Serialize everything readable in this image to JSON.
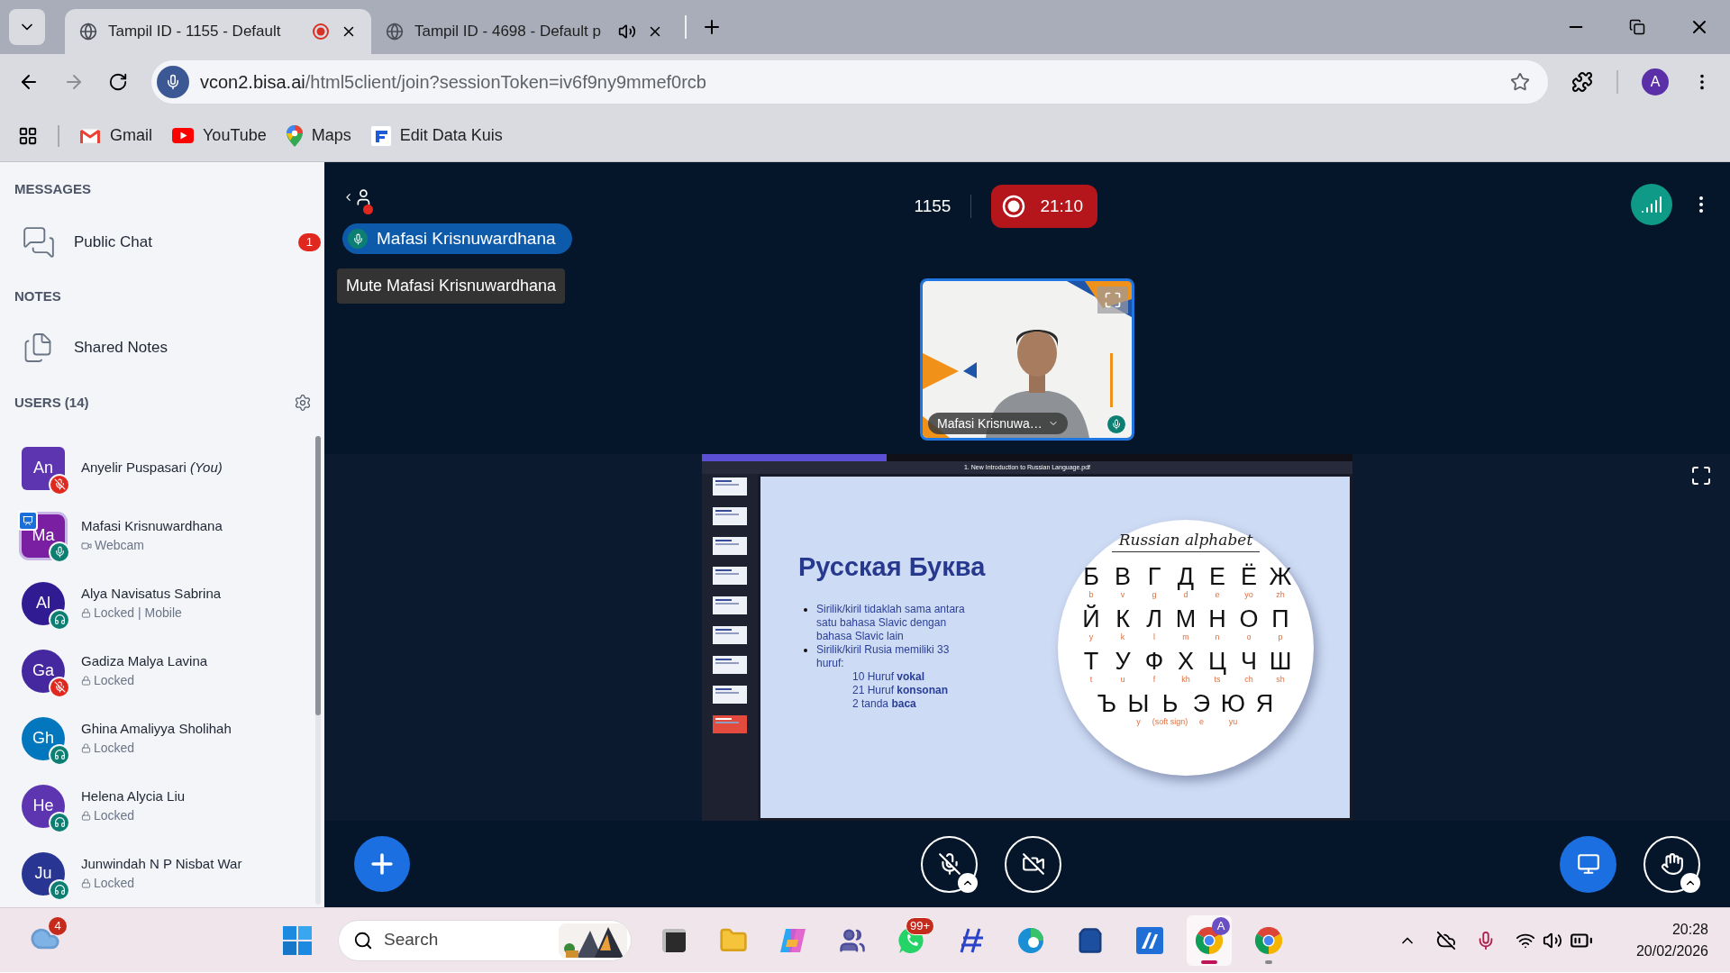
{
  "browser": {
    "tabs": [
      {
        "title": "Tampil ID - 1155 - Default",
        "selected": true,
        "recording": true,
        "playing_audio": false
      },
      {
        "title": "Tampil ID - 4698 - Default p",
        "selected": false,
        "recording": false,
        "playing_audio": true
      }
    ],
    "address": {
      "host": "vcon2.bisa.ai",
      "path": "/html5client/join?sessionToken=iv6f9ny9mmef0rcb"
    },
    "profile_initial": "A",
    "bookmarks": [
      {
        "label": "Gmail",
        "kind": "gmail"
      },
      {
        "label": "YouTube",
        "kind": "youtube"
      },
      {
        "label": "Maps",
        "kind": "maps"
      },
      {
        "label": "Edit Data Kuis",
        "kind": "flungo"
      }
    ]
  },
  "sidebar": {
    "messages_heading": "MESSAGES",
    "public_chat": {
      "label": "Public Chat",
      "unread": "1"
    },
    "notes_heading": "NOTES",
    "shared_notes": "Shared Notes",
    "users_heading": "USERS (14)",
    "users": [
      {
        "initials": "An",
        "name": "Anyelir Puspasari *(You)*",
        "color": "#5e35b1",
        "moderator": true,
        "presenter": false,
        "muted": true
      },
      {
        "initials": "Ma",
        "name": "Mafasi Krisnuwardhana",
        "color": "#7b1fa2",
        "moderator": true,
        "presenter": true,
        "muted": false,
        "listen_only": false,
        "status": {
          "kind": "webcam",
          "text": "Webcam"
        }
      },
      {
        "initials": "Al",
        "name": "Alya Navisatus Sabrina",
        "color": "#311b92",
        "moderator": false,
        "presenter": false,
        "muted": false,
        "listen_only": true,
        "status": {
          "kind": "lock",
          "text": "Locked | Mobile"
        }
      },
      {
        "initials": "Ga",
        "name": "Gadiza Malya Lavina",
        "color": "#4527a0",
        "moderator": false,
        "presenter": false,
        "muted": true,
        "status": {
          "kind": "lock",
          "text": "Locked"
        }
      },
      {
        "initials": "Gh",
        "name": "Ghina Amaliyya Sholihah",
        "color": "#0277bd",
        "moderator": false,
        "presenter": false,
        "muted": false,
        "listen_only": true,
        "status": {
          "kind": "lock",
          "text": "Locked"
        }
      },
      {
        "initials": "He",
        "name": "Helena Alycia Liu",
        "color": "#5e35b1",
        "moderator": false,
        "presenter": false,
        "muted": false,
        "listen_only": true,
        "status": {
          "kind": "lock",
          "text": "Locked"
        }
      },
      {
        "initials": "Ju",
        "name": "Junwindah N P Nisbat War",
        "color": "#283593",
        "moderator": false,
        "presenter": false,
        "muted": false,
        "listen_only": true,
        "status": {
          "kind": "lock",
          "text": "Locked"
        }
      }
    ]
  },
  "meeting": {
    "talking": "Mafasi Krisnuwardhana",
    "tooltip": "Mute Mafasi Krisnuwardhana",
    "room": "1155",
    "recording": {
      "on": true,
      "time": "21:10"
    },
    "webcam_name": "Mafasi Krisnuwa…",
    "controls": {
      "mic_muted": true,
      "camera_on": false,
      "presenting": true
    }
  },
  "slide": {
    "viewer_title": "1. New Introduction to Russian Language.pdf",
    "thumbnails": [
      {
        "selected": false
      },
      {
        "selected": false
      },
      {
        "selected": false
      },
      {
        "selected": false
      },
      {
        "selected": false
      },
      {
        "selected": false
      },
      {
        "selected": false
      },
      {
        "selected": false
      },
      {
        "selected": true
      }
    ],
    "title": "Русская Буква",
    "bullets": [
      "Sirilik/kiril tidaklah sama antara satu bahasa Slavic dengan bahasa Slavic lain",
      "Sirilik/kiril Rusia memiliki 33 huruf:"
    ],
    "sublines": [
      "10 Huruf **vokal**",
      "21 Huruf **konsonan**",
      "2 tanda **baca**"
    ],
    "alphabet_title": "Russian alphabet",
    "rows": [
      [
        {
          "letter": "Б",
          "translit": "b"
        },
        {
          "letter": "В",
          "translit": "v"
        },
        {
          "letter": "Г",
          "translit": "g"
        },
        {
          "letter": "Д",
          "translit": "d"
        },
        {
          "letter": "Е",
          "translit": "e"
        },
        {
          "letter": "Ё",
          "translit": "yo"
        },
        {
          "letter": "Ж",
          "translit": "zh"
        }
      ],
      [
        {
          "letter": "Й",
          "translit": "y"
        },
        {
          "letter": "К",
          "translit": "k"
        },
        {
          "letter": "Л",
          "translit": "l"
        },
        {
          "letter": "М",
          "translit": "m"
        },
        {
          "letter": "Н",
          "translit": "n"
        },
        {
          "letter": "О",
          "translit": "o"
        },
        {
          "letter": "П",
          "translit": "p"
        }
      ],
      [
        {
          "letter": "Т",
          "translit": "t"
        },
        {
          "letter": "У",
          "translit": "u"
        },
        {
          "letter": "Ф",
          "translit": "f"
        },
        {
          "letter": "Х",
          "translit": "kh"
        },
        {
          "letter": "Ц",
          "translit": "ts"
        },
        {
          "letter": "Ч",
          "translit": "ch"
        },
        {
          "letter": "Ш",
          "translit": "sh"
        }
      ],
      [
        {
          "letter": "Ъ"
        },
        {
          "letter": "Ы",
          "translit": "y"
        },
        {
          "letter": "Ь",
          "translit": "(soft sign)"
        },
        {
          "letter": "Э",
          "translit": "e"
        },
        {
          "letter": "Ю",
          "translit": "yu"
        },
        {
          "letter": "Я"
        }
      ]
    ]
  },
  "taskbar": {
    "weather_badge": "4",
    "search_placeholder": "Search",
    "apps": [
      {
        "kind": "taskview",
        "selected": false,
        "open": false
      },
      {
        "kind": "files",
        "selected": false,
        "open": false
      },
      {
        "kind": "copilot",
        "selected": false,
        "open": false
      },
      {
        "kind": "teams",
        "selected": false,
        "open": false
      },
      {
        "kind": "whatsapp",
        "selected": false,
        "open": false,
        "badge": "99+"
      },
      {
        "kind": "slash",
        "selected": false,
        "open": false
      },
      {
        "kind": "edge",
        "selected": false,
        "open": false
      },
      {
        "kind": "store",
        "selected": false,
        "open": false
      },
      {
        "kind": "azure",
        "selected": false,
        "open": false
      },
      {
        "kind": "chrome",
        "selected": true,
        "open": true,
        "badge": "A"
      },
      {
        "kind": "chrome",
        "selected": false,
        "open": true
      }
    ],
    "time": "20:28",
    "date": "20/02/2026"
  }
}
